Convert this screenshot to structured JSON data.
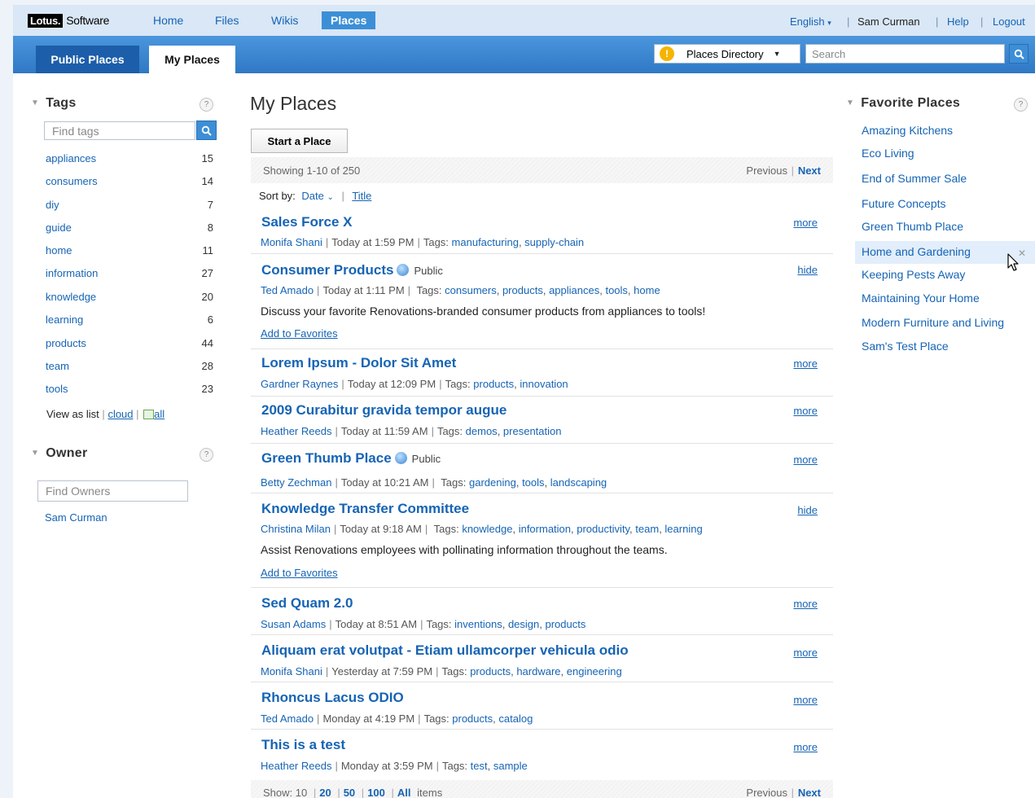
{
  "topnav": {
    "logo_lotus": "Lotus.",
    "logo_software": "Software",
    "links": [
      "Home",
      "Files",
      "Wikis",
      "Places"
    ],
    "active": "Places",
    "language": "English",
    "user": "Sam Curman",
    "help": "Help",
    "logout": "Logout"
  },
  "band": {
    "tab_public": "Public Places",
    "tab_my": "My Places",
    "directory": "Places Directory",
    "search_placeholder": "Search"
  },
  "tags": {
    "heading": "Tags",
    "find_placeholder": "Find tags",
    "items": [
      {
        "name": "appliances",
        "count": "15"
      },
      {
        "name": "consumers",
        "count": "14"
      },
      {
        "name": "diy",
        "count": "7"
      },
      {
        "name": "guide",
        "count": "8"
      },
      {
        "name": "home",
        "count": "11"
      },
      {
        "name": "information",
        "count": "27"
      },
      {
        "name": "knowledge",
        "count": "20"
      },
      {
        "name": "learning",
        "count": "6"
      },
      {
        "name": "products",
        "count": "44"
      },
      {
        "name": "team",
        "count": "28"
      },
      {
        "name": "tools",
        "count": "23"
      }
    ],
    "view_as": "View as list",
    "cloud": "cloud",
    "all": "all"
  },
  "owner": {
    "heading": "Owner",
    "find_placeholder": "Find Owners",
    "item": "Sam Curman"
  },
  "main": {
    "title": "My Places",
    "start_button": "Start a Place",
    "showing": "Showing 1-10 of 250",
    "previous": "Previous",
    "next": "Next",
    "sort_label": "Sort by:",
    "sort_date": "Date",
    "sort_title": "Title",
    "show_label": "Show: 10",
    "show_20": "20",
    "show_50": "50",
    "show_100": "100",
    "show_all": "All",
    "items_label": "items"
  },
  "places": [
    {
      "title": "Sales Force X",
      "owner": "Monifa Shani",
      "time": "Today at 1:59 PM",
      "tags_label": "Tags:",
      "tags": [
        "manufacturing",
        "supply-chain"
      ],
      "action": "more"
    },
    {
      "title": "Consumer Products",
      "public": "Public",
      "owner": "Ted Amado",
      "time": "Today at 1:11 PM",
      "tags_label": "Tags:",
      "tags": [
        "consumers",
        "products",
        "appliances",
        "tools",
        "home"
      ],
      "description": "Discuss your favorite Renovations-branded consumer products from appliances to tools!",
      "favorite": "Add to Favorites",
      "action": "hide"
    },
    {
      "title": "Lorem Ipsum - Dolor Sit Amet",
      "owner": "Gardner Raynes",
      "time": "Today at 12:09 PM",
      "tags_label": "Tags:",
      "tags": [
        "products",
        "innovation"
      ],
      "action": "more"
    },
    {
      "title": "2009 Curabitur gravida tempor augue",
      "owner": "Heather Reeds",
      "time": "Today at 11:59 AM",
      "tags_label": "Tags:",
      "tags": [
        "demos",
        "presentation"
      ],
      "action": "more"
    },
    {
      "title": "Green Thumb Place",
      "public": "Public",
      "owner": "Betty Zechman",
      "time": "Today at 10:21 AM",
      "tags_label": "Tags:",
      "tags": [
        "gardening",
        "tools",
        "landscaping"
      ],
      "action": "more"
    },
    {
      "title": "Knowledge Transfer Committee",
      "owner": "Christina Milan",
      "time": "Today at 9:18 AM",
      "tags_label": "Tags:",
      "tags": [
        "knowledge",
        "information",
        "productivity",
        "team",
        "learning"
      ],
      "description": "Assist Renovations employees with pollinating information throughout the teams.",
      "favorite": "Add to Favorites",
      "action": "hide"
    },
    {
      "title": "Sed Quam 2.0",
      "owner": "Susan Adams",
      "time": "Today at 8:51 AM",
      "tags_label": "Tags:",
      "tags": [
        "inventions",
        "design",
        "products"
      ],
      "action": "more"
    },
    {
      "title": "Aliquam erat volutpat - Etiam ullamcorper vehicula odio",
      "owner": "Monifa Shani",
      "time": "Yesterday at 7:59 PM",
      "tags_label": "Tags:",
      "tags": [
        "products",
        "hardware",
        "engineering"
      ],
      "action": "more"
    },
    {
      "title": "Rhoncus Lacus ODIO",
      "owner": "Ted Amado",
      "time": "Monday at 4:19 PM",
      "tags_label": "Tags:",
      "tags": [
        "products",
        "catalog"
      ],
      "action": "more"
    },
    {
      "title": "This is a test",
      "owner": "Heather Reeds",
      "time": "Monday at 3:59 PM",
      "tags_label": "Tags:",
      "tags": [
        "test",
        "sample"
      ],
      "action": "more"
    }
  ],
  "favorites": {
    "heading": "Favorite Places",
    "items": [
      "Amazing Kitchens",
      "Eco Living",
      "End of Summer Sale",
      "Future Concepts",
      "Green Thumb Place",
      "Home and Gardening",
      "Keeping Pests Away",
      "Maintaining Your Home",
      "Modern Furniture and Living",
      "Sam's Test Place"
    ],
    "hovered": "Home and Gardening"
  },
  "colors": {
    "accent": "#3c8fd6",
    "link": "#1664b4",
    "band": "#2f78c5"
  }
}
